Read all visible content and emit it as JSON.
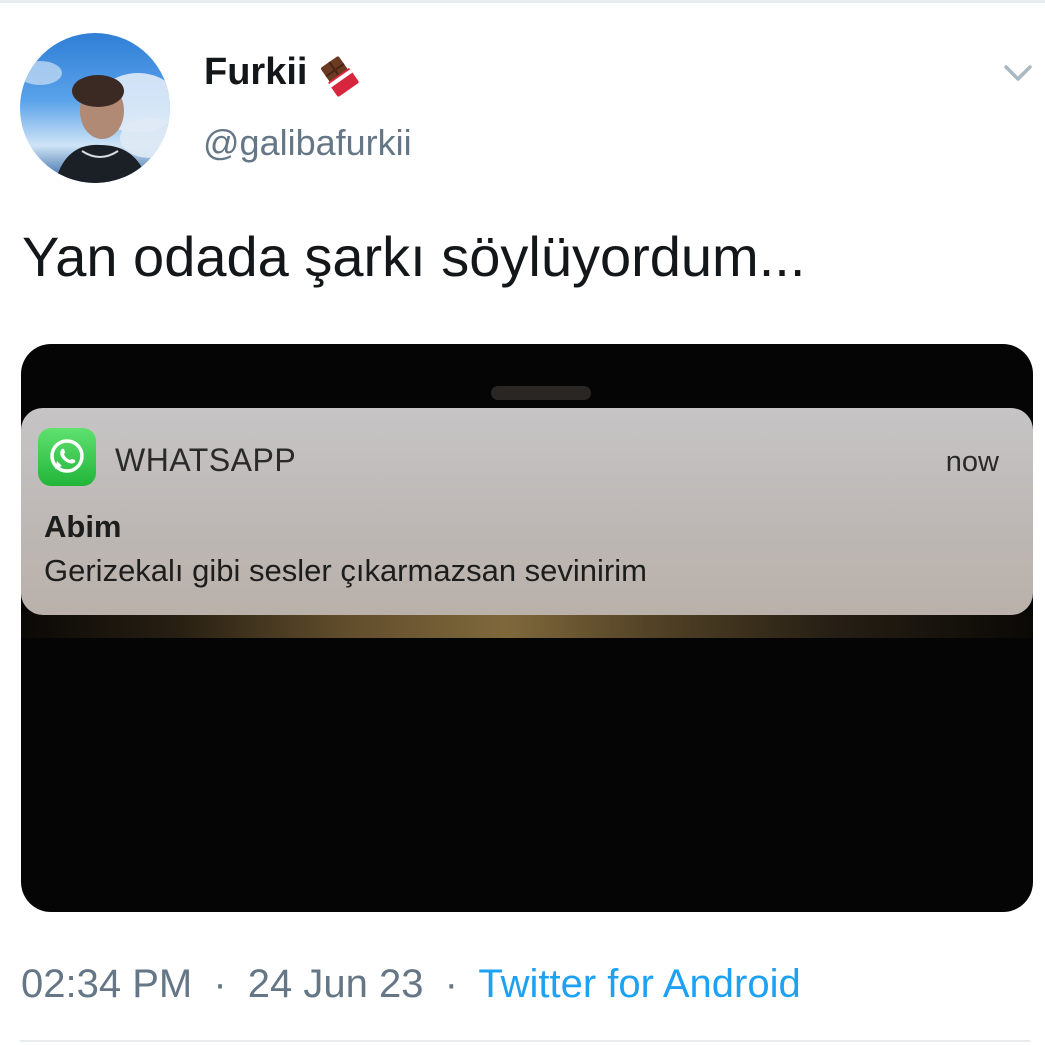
{
  "tweet": {
    "author_name": "Furkii",
    "author_handle": "@galibafurkii",
    "text": "Yan odada şarkı söylüyordum...",
    "name_emoji": "chocolate-bar-icon",
    "menu_icon": "chevron-down-icon"
  },
  "media": {
    "notification": {
      "app_icon": "whatsapp-icon",
      "app_name": "WHATSAPP",
      "time": "now",
      "sender": "Abim",
      "message": "Gerizekalı gibi sesler çıkarmazsan sevinirim"
    }
  },
  "meta": {
    "time": "02:34 PM",
    "separator": "·",
    "date": "24 Jun 23",
    "source": "Twitter for Android"
  },
  "colors": {
    "text_primary": "#14171a",
    "text_secondary": "#657786",
    "link": "#1da1f2",
    "whatsapp_green": "#25d366"
  }
}
